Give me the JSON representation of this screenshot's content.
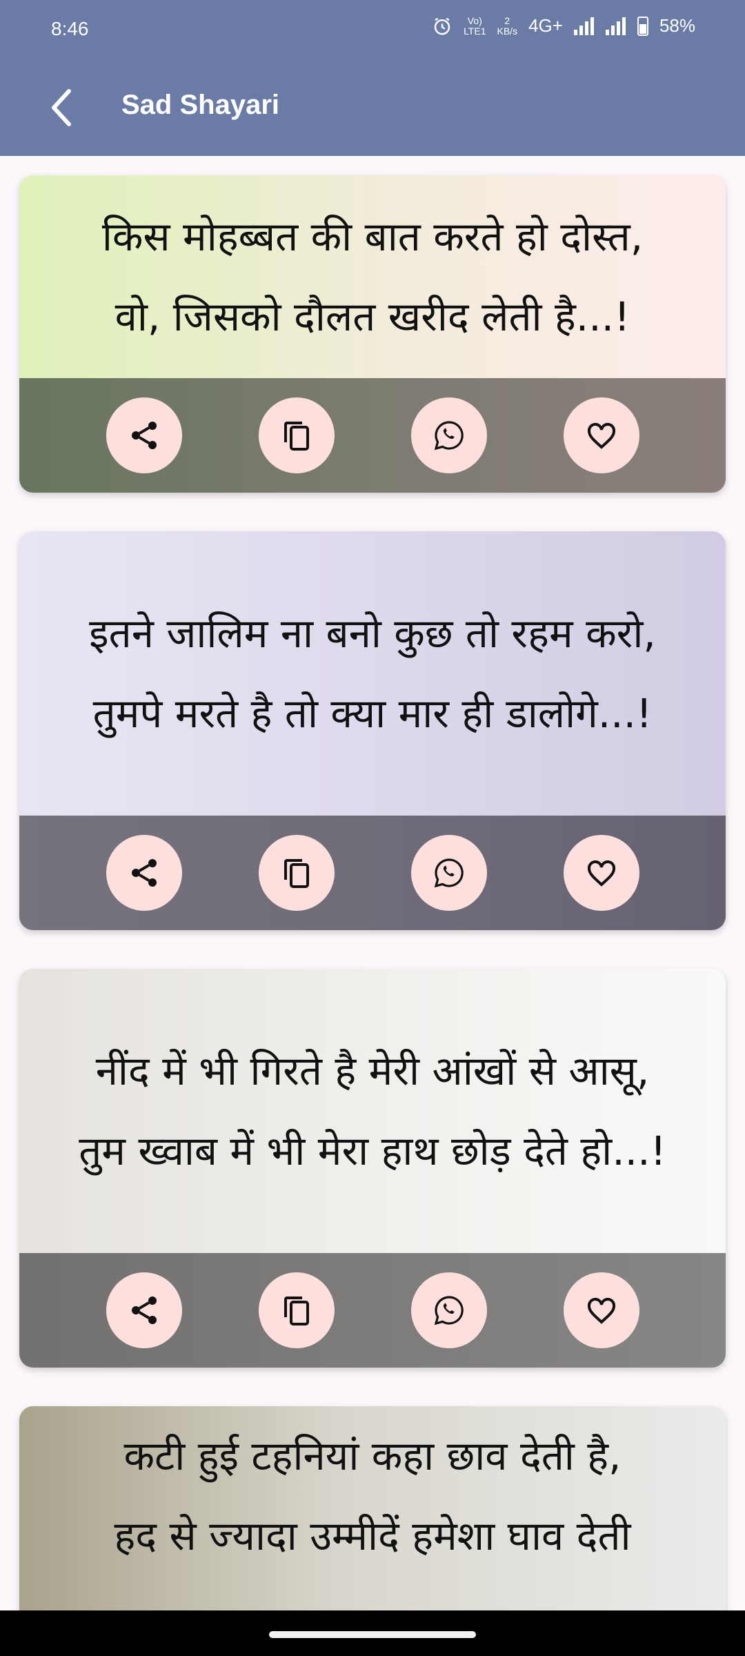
{
  "status_bar": {
    "time": "8:46",
    "volte": "Vo)\nLTE1",
    "speed": "2\nKB/s",
    "network": "4G+",
    "battery": "58%"
  },
  "app_bar": {
    "title": "Sad Shayari",
    "back_icon": "chevron-left-icon"
  },
  "cards": [
    {
      "text": "किस मोहब्बत की बात करते हो दोस्त,\nवो, जिसको दौलत खरीद लेती है...!"
    },
    {
      "text": "इतने जालिम ना बनो कुछ तो रहम करो,\nतुमपे मरते है तो क्या मार ही डालोगे...!"
    },
    {
      "text": "नींद में भी गिरते है मेरी आंखों से आसू,\nतुम ख्वाब में भी मेरा हाथ छोड़ देते हो...!"
    },
    {
      "text": "कटी हुई टहनियां कहा छाव देती है,\nहद से ज्यादा उम्मीदें हमेशा घाव देती"
    }
  ],
  "card_actions": [
    "share-icon",
    "copy-icon",
    "whatsapp-icon",
    "heart-icon"
  ],
  "colors": {
    "app_bar": "#6a7ba6",
    "action_button": "#fde0dd",
    "background": "#fcf7fb"
  }
}
